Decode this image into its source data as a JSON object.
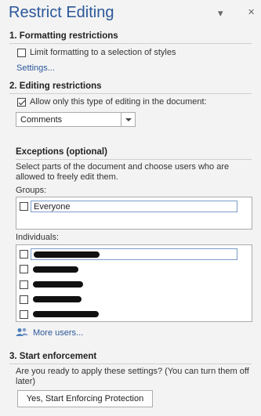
{
  "pane": {
    "title": "Restrict Editing",
    "options_glyph": "▾",
    "close_glyph": "✕"
  },
  "formatting": {
    "heading": "1. Formatting restrictions",
    "limit_label": "Limit formatting to a selection of styles",
    "limit_checked": false,
    "settings_link": "Settings..."
  },
  "editing": {
    "heading": "2. Editing restrictions",
    "allow_label": "Allow only this type of editing in the document:",
    "allow_checked": true,
    "mode_value": "Comments"
  },
  "exceptions": {
    "heading": "Exceptions (optional)",
    "description": "Select parts of the document and choose users who are allowed to freely edit them.",
    "groups_label": "Groups:",
    "groups": [
      {
        "name": "Everyone",
        "checked": false
      }
    ],
    "individuals_label": "Individuals:",
    "individuals_count": 5,
    "more_users_link": "More users..."
  },
  "enforcement": {
    "heading": "3. Start enforcement",
    "description": "Are you ready to apply these settings? (You can turn them off later)",
    "start_button": "Yes, Start Enforcing Protection"
  },
  "colors": {
    "title": "#2b579a",
    "link": "#2b579a",
    "background": "#f3f3f3"
  }
}
